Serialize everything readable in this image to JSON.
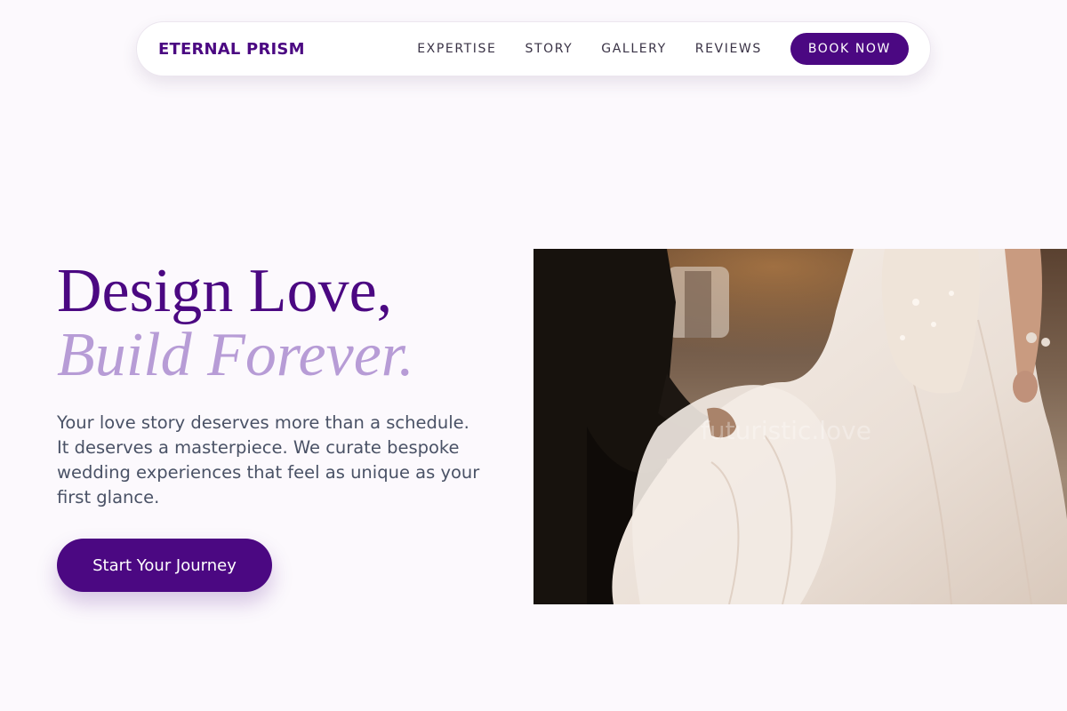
{
  "nav": {
    "brand": "ETERNAL PRISM",
    "links": [
      "EXPERTISE",
      "STORY",
      "GALLERY",
      "REVIEWS"
    ],
    "book_label": "BOOK NOW"
  },
  "hero": {
    "title_line1": "Design Love,",
    "title_line2": "Build Forever.",
    "subtitle": "Your love story deserves more than a schedule. It deserves a masterpiece. We curate bespoke wedding experiences that feel as unique as your first glance.",
    "cta_label": "Start Your Journey"
  },
  "image": {
    "subject": "couple-walking-bride-dress-photo",
    "watermark": "futuristic.love"
  },
  "colors": {
    "brand_purple": "#4b0882",
    "accent_lavender": "#b79cd6",
    "page_background": "#fcf9fd",
    "body_text": "#4a5266"
  }
}
